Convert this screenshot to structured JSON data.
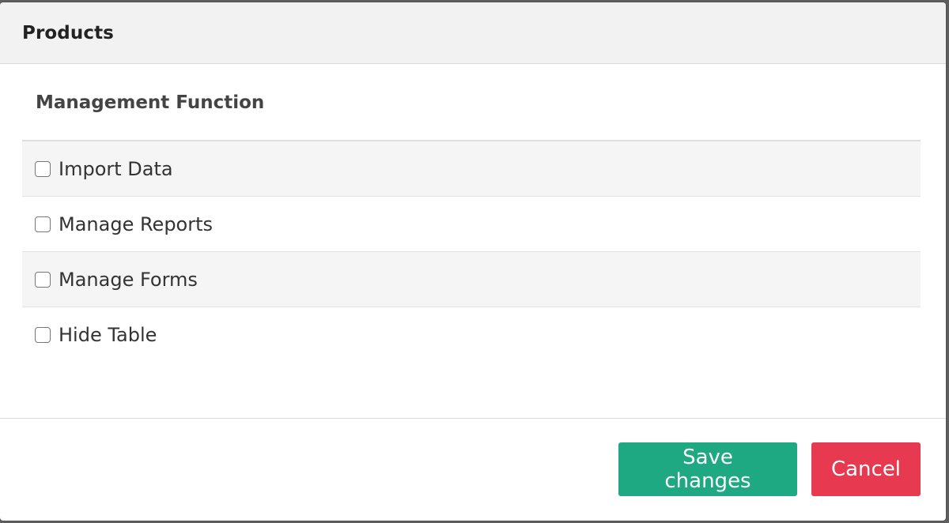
{
  "modal": {
    "title": "Products"
  },
  "section": {
    "heading": "Management Function",
    "items": [
      {
        "label": "Import Data",
        "checked": false
      },
      {
        "label": "Manage Reports",
        "checked": false
      },
      {
        "label": "Manage Forms",
        "checked": false
      },
      {
        "label": "Hide Table",
        "checked": false
      }
    ]
  },
  "footer": {
    "save_label": "Save changes",
    "cancel_label": "Cancel"
  },
  "colors": {
    "save": "#1ea982",
    "cancel": "#e73a51",
    "header_bg": "#f2f2f2",
    "stripe_bg": "#f5f5f5"
  }
}
